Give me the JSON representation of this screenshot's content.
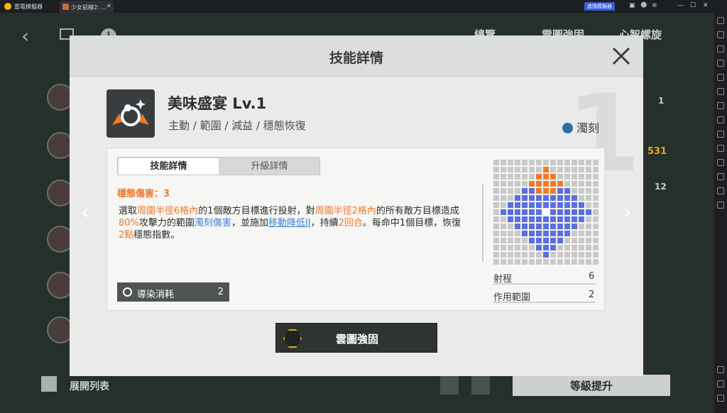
{
  "titlebar": {
    "app_name": "雷電模擬器",
    "tab_label": "少女前線2: ...",
    "tab_close": "✕",
    "sync_button": "進階模擬器",
    "controls": [
      "▣",
      "☻",
      "≡",
      "—",
      "☐",
      "✕"
    ]
  },
  "background": {
    "back_icon": "‹",
    "info_icon": "i",
    "tab_overview": "總覽",
    "tab_cloud": "雲圖強固",
    "tab_mind": "心智螺旋",
    "value_531": "531",
    "value_12": "12",
    "value_1": "1",
    "expand_list": "展開列表",
    "level_up": "等級提升"
  },
  "modal": {
    "title": "技能詳情",
    "big_number": "1",
    "skill_name": "美味盛宴 Lv.1",
    "skill_tags": "主動 / 範圍 / 減益 / 穩態恢復",
    "element": "濁刻",
    "tab_detail": "技能詳情",
    "tab_upgrade": "升級詳情",
    "damage_line": "穩態傷害：3",
    "desc_parts": [
      "選取",
      "周圍半徑6格內",
      "的1個敵方目標進行投射，對",
      "周圍半徑2格內",
      "的所有敵方目標造成",
      "80%",
      "攻擊力的範圍",
      "濁刻傷害",
      "，並施加",
      "移動降低II",
      "，持續",
      "2回合",
      "。每命中1個目標，恢復",
      "2點",
      "穩態指數。"
    ],
    "cost_label": "導染消耗",
    "cost_value": "2",
    "stat_range_label": "射程",
    "stat_range_value": "6",
    "stat_area_label": "作用範圍",
    "stat_area_value": "2",
    "enhance_button": "雲圖強固",
    "prev_arrow": "‹",
    "next_arrow": "›"
  },
  "grid": {
    "size": 15,
    "origin_row": 7,
    "origin_col": 7,
    "range_radius": 6,
    "area_radius": 2,
    "colors": {
      "empty": "#c9cac7",
      "range": "#5a6fe0",
      "area": "#f07a2a",
      "origin": "#ffffff"
    }
  },
  "colors": {
    "accent_orange": "#f07a2a",
    "accent_blue": "#3d86d6",
    "sync_blue": "#3b5bdb"
  }
}
